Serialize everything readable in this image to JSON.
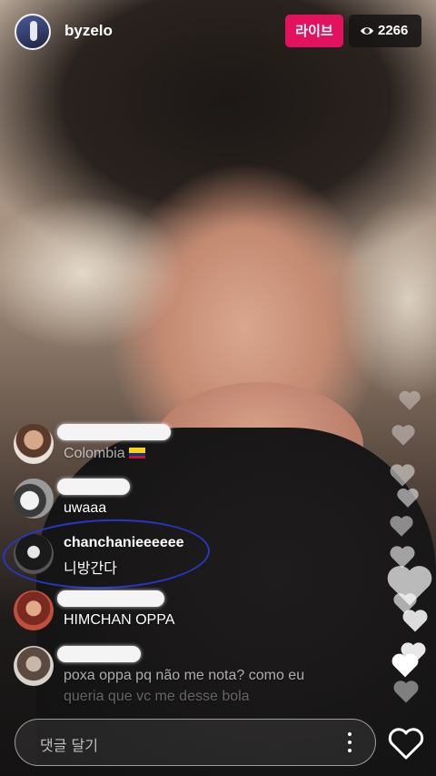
{
  "header": {
    "host_username": "byzelo",
    "live_label": "라이브",
    "viewer_count": "2266"
  },
  "comments": [
    {
      "username": "",
      "text": "Colombia"
    },
    {
      "username": "",
      "text": "uwaaa"
    },
    {
      "username": "chanchanieeeeee",
      "text": "니방간다"
    },
    {
      "username": "",
      "text": "HIMCHAN OPPA"
    },
    {
      "username": "",
      "text": "poxa oppa pq não me nota? como eu",
      "text_line2": "queria que vc me desse bola"
    }
  ],
  "comment_input": {
    "placeholder": "댓글 달기"
  },
  "colors": {
    "live_badge": "#e3125f",
    "annotation_circle": "#2637c9"
  }
}
